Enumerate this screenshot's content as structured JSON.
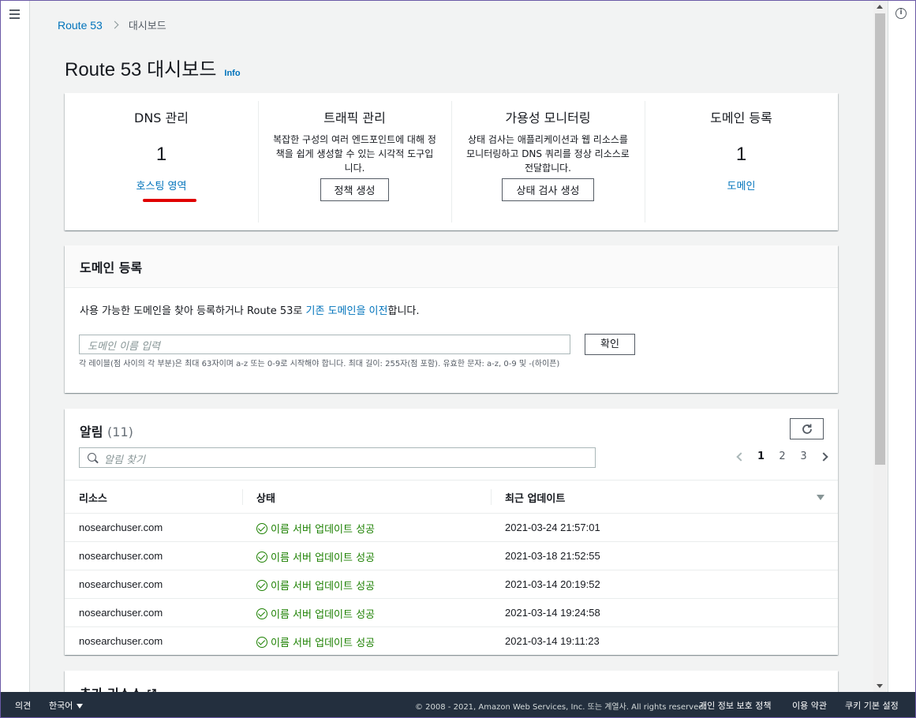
{
  "breadcrumb": {
    "root": "Route 53",
    "current": "대시보드"
  },
  "page": {
    "title": "Route 53 대시보드",
    "info": "Info"
  },
  "overview": {
    "dns": {
      "heading": "DNS 관리",
      "count": "1",
      "link": "호스팅 영역"
    },
    "traffic": {
      "heading": "트래픽 관리",
      "desc": "복잡한 구성의 여러 엔드포인트에 대해 정책을 쉽게 생성할 수 있는 시각적 도구입니다.",
      "button": "정책 생성"
    },
    "availability": {
      "heading": "가용성 모니터링",
      "desc": "상태 검사는 애플리케이션과 웹 리소스를 모니터링하고 DNS 쿼리를 정상 리소스로 전달합니다.",
      "button": "상태 검사 생성"
    },
    "registration": {
      "heading": "도메인 등록",
      "count": "1",
      "link": "도메인"
    }
  },
  "domain_panel": {
    "title": "도메인 등록",
    "desc_prefix": "사용 가능한 도메인을 찾아 등록하거나 Route 53로 ",
    "desc_link": "기존 도메인을 이전",
    "desc_suffix": "합니다.",
    "input_placeholder": "도메인 이름 입력",
    "button": "확인",
    "hint": "각 레이블(점 사이의 각 부분)은 최대 63자이며 a-z 또는 0-9로 시작해야 합니다. 최대 길이: 255자(점 포함). 유효한 문자: a-z, 0-9 및 -(하이픈)"
  },
  "alarms": {
    "title": "알림",
    "count": "(11)",
    "search_placeholder": "알림 찾기",
    "pages": [
      "1",
      "2",
      "3"
    ],
    "current_page": "1",
    "columns": [
      "리소스",
      "상태",
      "최근 업데이트"
    ],
    "rows": [
      {
        "resource": "nosearchuser.com",
        "status": "이름 서버 업데이트 성공",
        "updated": "2021-03-24 21:57:01"
      },
      {
        "resource": "nosearchuser.com",
        "status": "이름 서버 업데이트 성공",
        "updated": "2021-03-18 21:52:55"
      },
      {
        "resource": "nosearchuser.com",
        "status": "이름 서버 업데이트 성공",
        "updated": "2021-03-14 20:19:52"
      },
      {
        "resource": "nosearchuser.com",
        "status": "이름 서버 업데이트 성공",
        "updated": "2021-03-14 19:24:58"
      },
      {
        "resource": "nosearchuser.com",
        "status": "이름 서버 업데이트 성공",
        "updated": "2021-03-14 19:11:23"
      }
    ]
  },
  "more_resources": {
    "title": "추가 리소스"
  },
  "footer": {
    "feedback": "의견",
    "language": "한국어",
    "copyright": "© 2008 - 2021, Amazon Web Services, Inc. 또는 계열사. All rights reserved.",
    "privacy": "개인 정보 보호 정책",
    "terms": "이용 약관",
    "cookies": "쿠키 기본 설정"
  },
  "colors": {
    "link": "#0073bb",
    "success": "#1d8102",
    "footer_bg": "#232f3e",
    "highlight": "#e00000"
  },
  "icons": {
    "menu": "hamburger-icon",
    "info": "info-icon",
    "refresh": "refresh-icon",
    "search": "search-icon",
    "success": "check-circle-icon",
    "external": "external-link-icon"
  }
}
